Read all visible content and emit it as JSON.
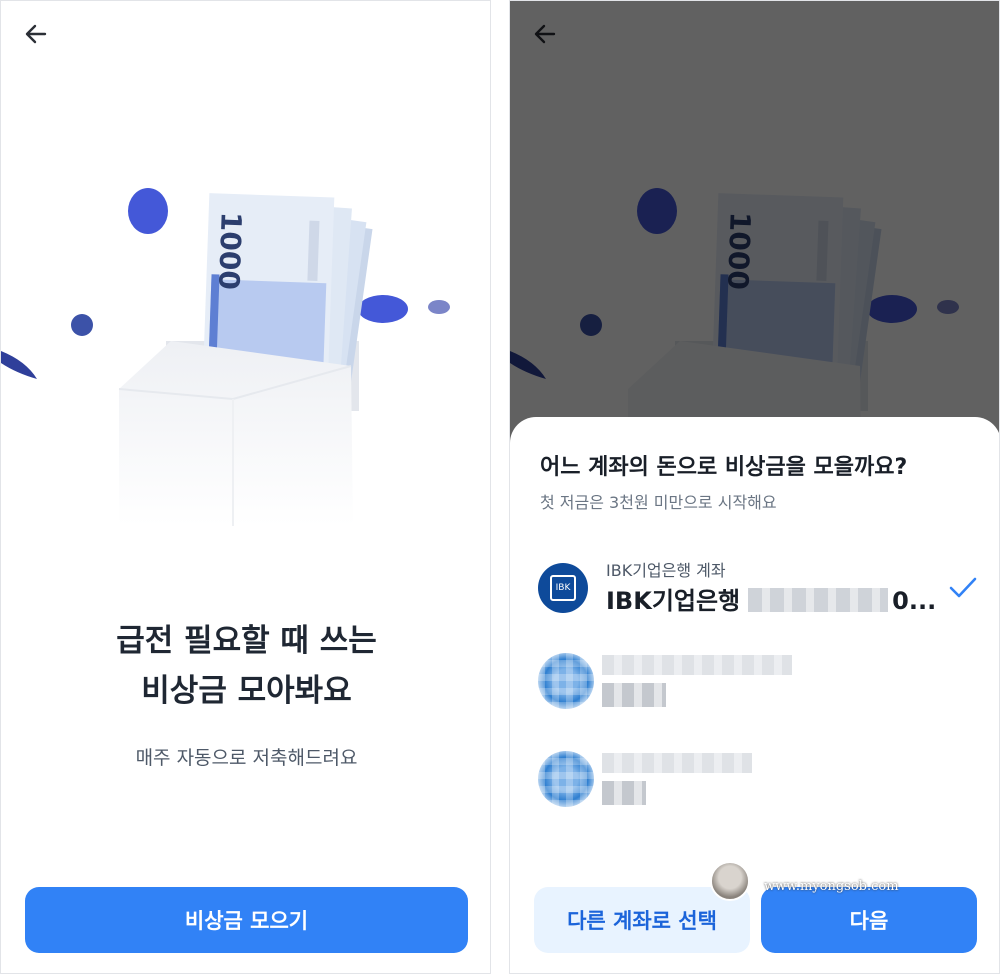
{
  "left_screen": {
    "back_icon": "arrow-left-icon",
    "headline_line1": "급전 필요할 때 쓰는",
    "headline_line2": "비상금 모아봐요",
    "subtext": "매주 자동으로 저축해드려요",
    "primary_button": "비상금 모으기",
    "banknote_denomination": "1000"
  },
  "right_screen": {
    "back_icon": "arrow-left-icon",
    "banknote_denomination": "1000",
    "sheet": {
      "title": "어느 계좌의 돈으로 비상금을 모을까요?",
      "subtitle": "첫 저금은 3천원 미만으로 시작해요",
      "selected_account": {
        "label": "IBK기업은행 계좌",
        "name": "IBK기업은행",
        "suffix": "0...",
        "logo_text": "IBK"
      },
      "secondary_button": "다른 계좌로 선택",
      "primary_button": "다음"
    },
    "watermark": "www.myongsob.com"
  },
  "colors": {
    "primary": "#3182f6",
    "secondary_bg": "#e8f3ff",
    "secondary_text": "#1b64da",
    "ibk_blue": "#0e4a9a",
    "coin_blue": "#4458d8"
  }
}
